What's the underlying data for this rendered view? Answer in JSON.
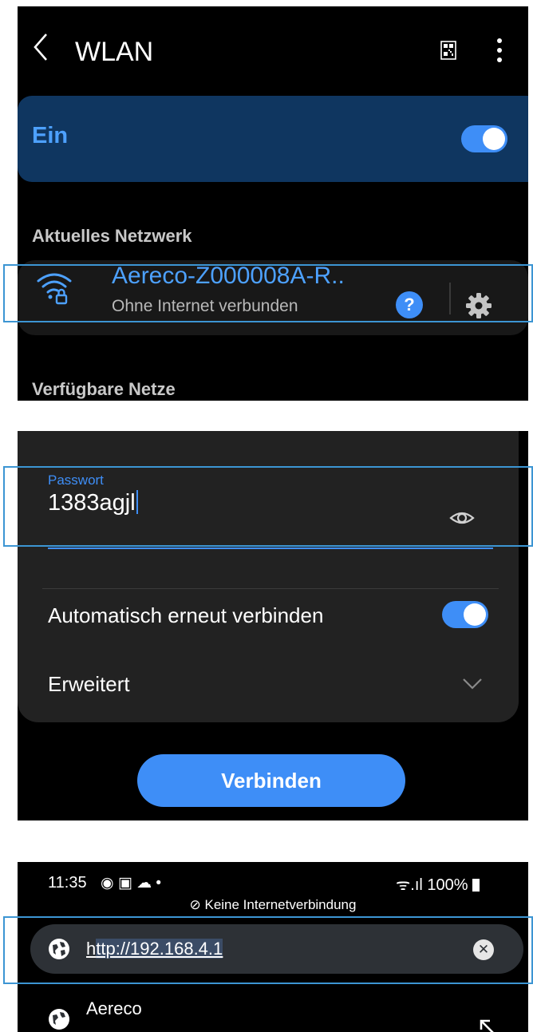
{
  "wlan": {
    "title": "WLAN",
    "toggle_label": "Ein",
    "toggle_on": true,
    "current_network_header": "Aktuelles Netzwerk",
    "network": {
      "name": "Aereco-Z000008A-R..",
      "status": "Ohne Internet verbunden"
    },
    "help_label": "?",
    "available_header": "Verfügbare Netze"
  },
  "password_dialog": {
    "field_label": "Passwort",
    "field_value": "1383agjl",
    "auto_reconnect_label": "Automatisch erneut verbinden",
    "auto_reconnect_on": true,
    "advanced_label": "Erweitert",
    "connect_label": "Verbinden"
  },
  "browser": {
    "status_time": "11:35",
    "status_icons": "◉ ▣ ☁ •",
    "signal": "ᯤ.ıl",
    "battery": "100%",
    "notice": "Keine Internetverbindung",
    "url_plain": "h",
    "url_selected": "ttp://192.168.4.1",
    "clear_label": "✕",
    "suggestion_title": "Aereco"
  },
  "colors": {
    "accent": "#3e8ef7",
    "toggle_bar": "#0f3660",
    "highlight_box": "#3c95d3"
  }
}
